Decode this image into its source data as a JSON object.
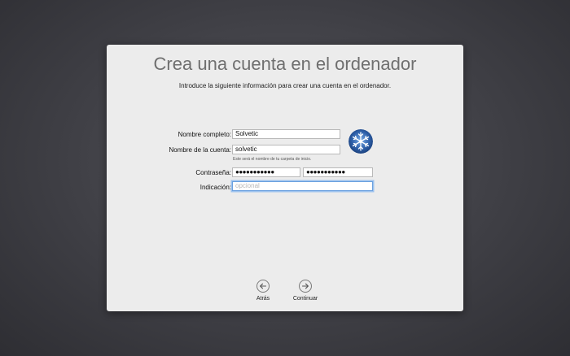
{
  "dialog": {
    "title": "Crea una cuenta en el ordenador",
    "subtitle": "Introduce la siguiente información para crear una cuenta en el ordenador."
  },
  "form": {
    "full_name_label": "Nombre completo:",
    "full_name_value": "Solvetic",
    "account_name_label": "Nombre de la cuenta:",
    "account_name_value": "solvetic",
    "account_name_hint": "Este será el nombre de tu carpeta de inicio.",
    "password_label": "Contraseña:",
    "password_value": "●●●●●●●●●●●",
    "verify_value": "●●●●●●●●●●●",
    "hint_label": "Indicación:",
    "hint_placeholder": "opcional"
  },
  "avatar": {
    "icon": "snowflake-icon",
    "color": "#2d5fa8"
  },
  "nav": {
    "back_label": "Atrás",
    "continue_label": "Continuar"
  }
}
